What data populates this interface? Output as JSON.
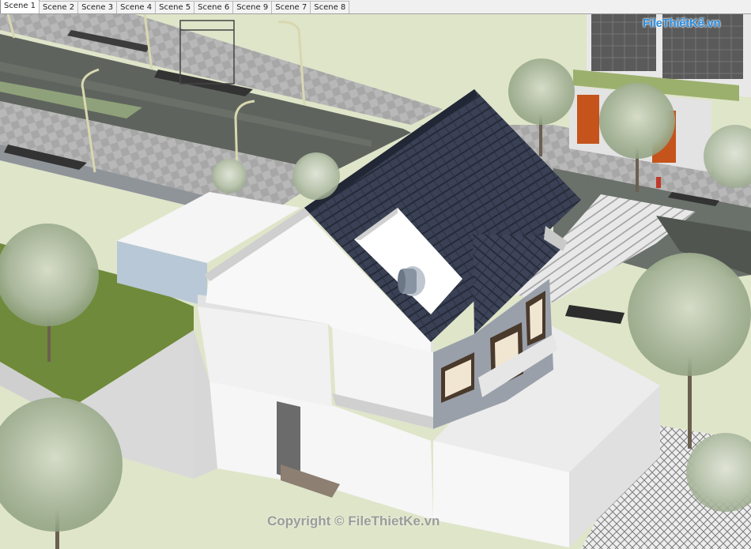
{
  "scene_tabs": [
    {
      "label": "Scene 1",
      "active": true
    },
    {
      "label": "Scene 2",
      "active": false
    },
    {
      "label": "Scene 3",
      "active": false
    },
    {
      "label": "Scene 4",
      "active": false
    },
    {
      "label": "Scene 5",
      "active": false
    },
    {
      "label": "Scene 6",
      "active": false
    },
    {
      "label": "Scene 9",
      "active": false
    },
    {
      "label": "Scene 7",
      "active": false
    },
    {
      "label": "Scene 8",
      "active": false
    }
  ],
  "watermark": {
    "logo_text": "FileThiếtKế.vn",
    "copyright": "Copyright © FileThietKe.vn"
  },
  "colors": {
    "roof": "#343b4f",
    "wall": "#f4f4f4",
    "lawn": "#6f8a3a",
    "ground": "#dde3c8",
    "road": "#5c615b",
    "paving": "#b3b3b3",
    "door": "#c4541c",
    "logo": "#2a8ee0"
  }
}
